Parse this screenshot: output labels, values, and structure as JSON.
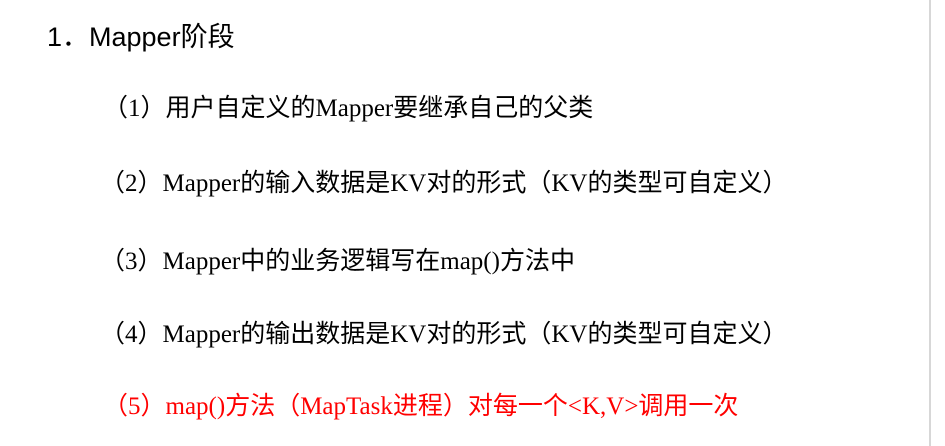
{
  "heading": "1．Mapper阶段",
  "items": [
    {
      "text": "（1）用户自定义的Mapper要继承自己的父类"
    },
    {
      "text": "（2）Mapper的输入数据是KV对的形式（KV的类型可自定义）"
    },
    {
      "text": "（3）Mapper中的业务逻辑写在map()方法中"
    },
    {
      "text": "（4）Mapper的输出数据是KV对的形式（KV的类型可自定义）"
    },
    {
      "text": "（5）map()方法（MapTask进程）对每一个<K,V>调用一次"
    }
  ],
  "colors": {
    "text": "#000000",
    "highlight": "#ff0000",
    "background": "#ffffff"
  }
}
